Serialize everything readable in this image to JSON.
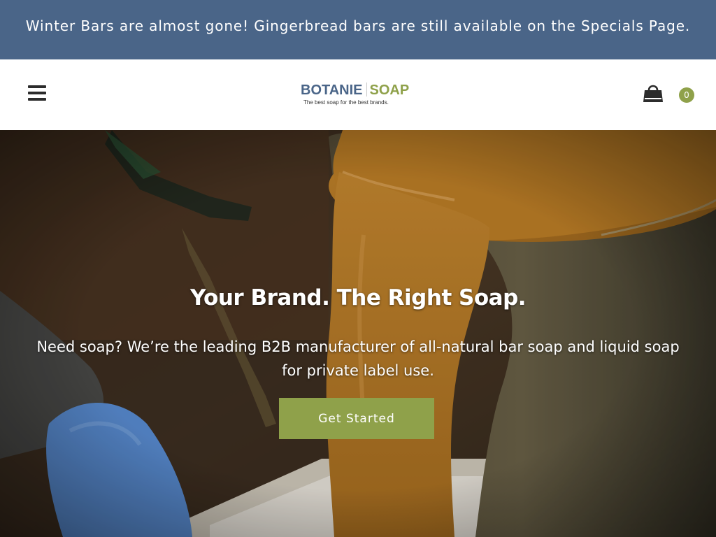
{
  "announcement": {
    "text": "Winter Bars are almost gone! Gingerbread bars are still available on the Specials Page."
  },
  "header": {
    "menu_icon": "hamburger-menu-icon",
    "logo": {
      "primary": "BOTANIE",
      "secondary": "SOAP",
      "tagline": "The best soap for the best brands."
    },
    "cart_icon": "shopping-bag-icon",
    "cart_count": "0"
  },
  "hero": {
    "title": "Your Brand. The Right Soap.",
    "subtitle": "Need soap? We’re the leading B2B manufacturer of all-natural bar soap and liquid soap for private label use.",
    "cta_label": "Get Started",
    "image": "liquid-soap-pouring-photo"
  },
  "colors": {
    "announcement_bg": "#4a6588",
    "brand_blue": "#4a6588",
    "brand_green": "#8fa14a",
    "text_dark": "#2c2c2c"
  }
}
